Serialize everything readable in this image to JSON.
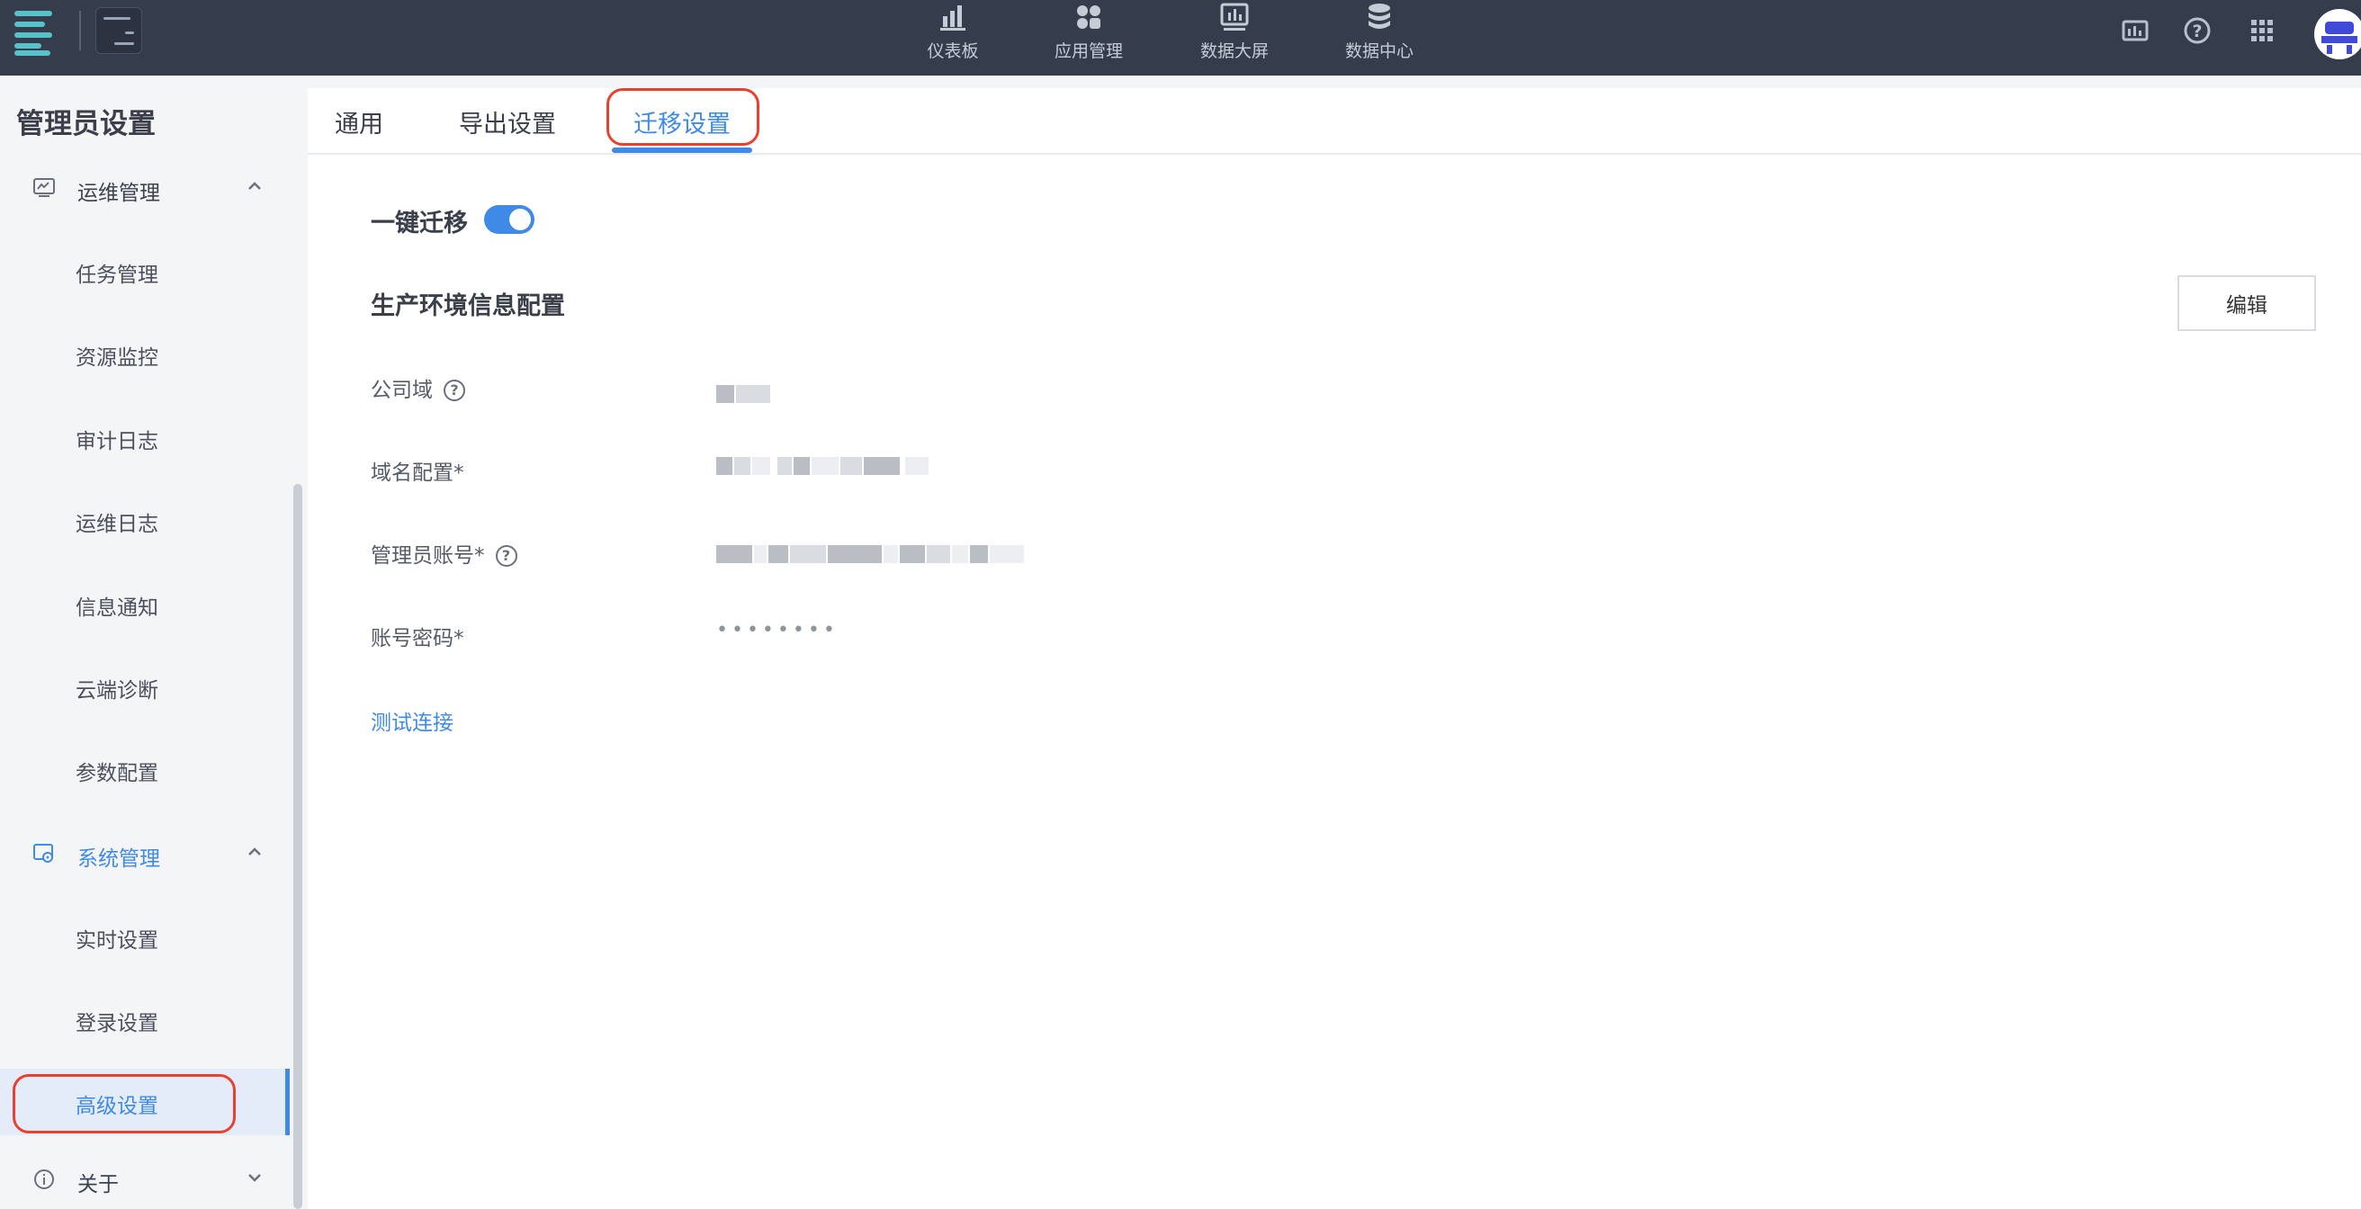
{
  "topbar": {
    "nav": [
      {
        "label": "仪表板",
        "icon": "bar-chart-icon"
      },
      {
        "label": "应用管理",
        "icon": "apps-icon"
      },
      {
        "label": "数据大屏",
        "icon": "screen-icon"
      },
      {
        "label": "数据中心",
        "icon": "database-icon"
      }
    ],
    "right_icons": [
      "dashboard-stats-icon",
      "help-icon",
      "grid-icon",
      "avatar"
    ]
  },
  "sidebar": {
    "title": "管理员设置",
    "groups": [
      {
        "label": "运维管理",
        "icon": "monitor-icon",
        "expanded": true,
        "items": [
          "任务管理",
          "资源监控",
          "审计日志",
          "运维日志",
          "信息通知",
          "云端诊断",
          "参数配置"
        ]
      },
      {
        "label": "系统管理",
        "icon": "system-settings-icon",
        "expanded": true,
        "items": [
          "实时设置",
          "登录设置",
          "高级设置"
        ],
        "active_item": "高级设置"
      },
      {
        "label": "关于",
        "icon": "info-icon",
        "expanded": false,
        "items": []
      }
    ]
  },
  "tabs": [
    "通用",
    "导出设置",
    "迁移设置"
  ],
  "active_tab": "迁移设置",
  "migration": {
    "one_click_label": "一键迁移",
    "one_click_enabled": true,
    "section_title": "生产环境信息配置",
    "edit_label": "编辑",
    "fields": [
      {
        "label": "公司域",
        "help": true,
        "value": "(blurred)"
      },
      {
        "label": "域名配置*",
        "help": false,
        "value": "(blurred)"
      },
      {
        "label": "管理员账号*",
        "help": true,
        "value": "(blurred)"
      },
      {
        "label": "账号密码*",
        "help": false,
        "value": "••••••••"
      }
    ],
    "test_link": "测试连接"
  },
  "colors": {
    "topbar": "#353c4c",
    "accent": "#3f8ae6",
    "annotation": "#e8412f"
  }
}
